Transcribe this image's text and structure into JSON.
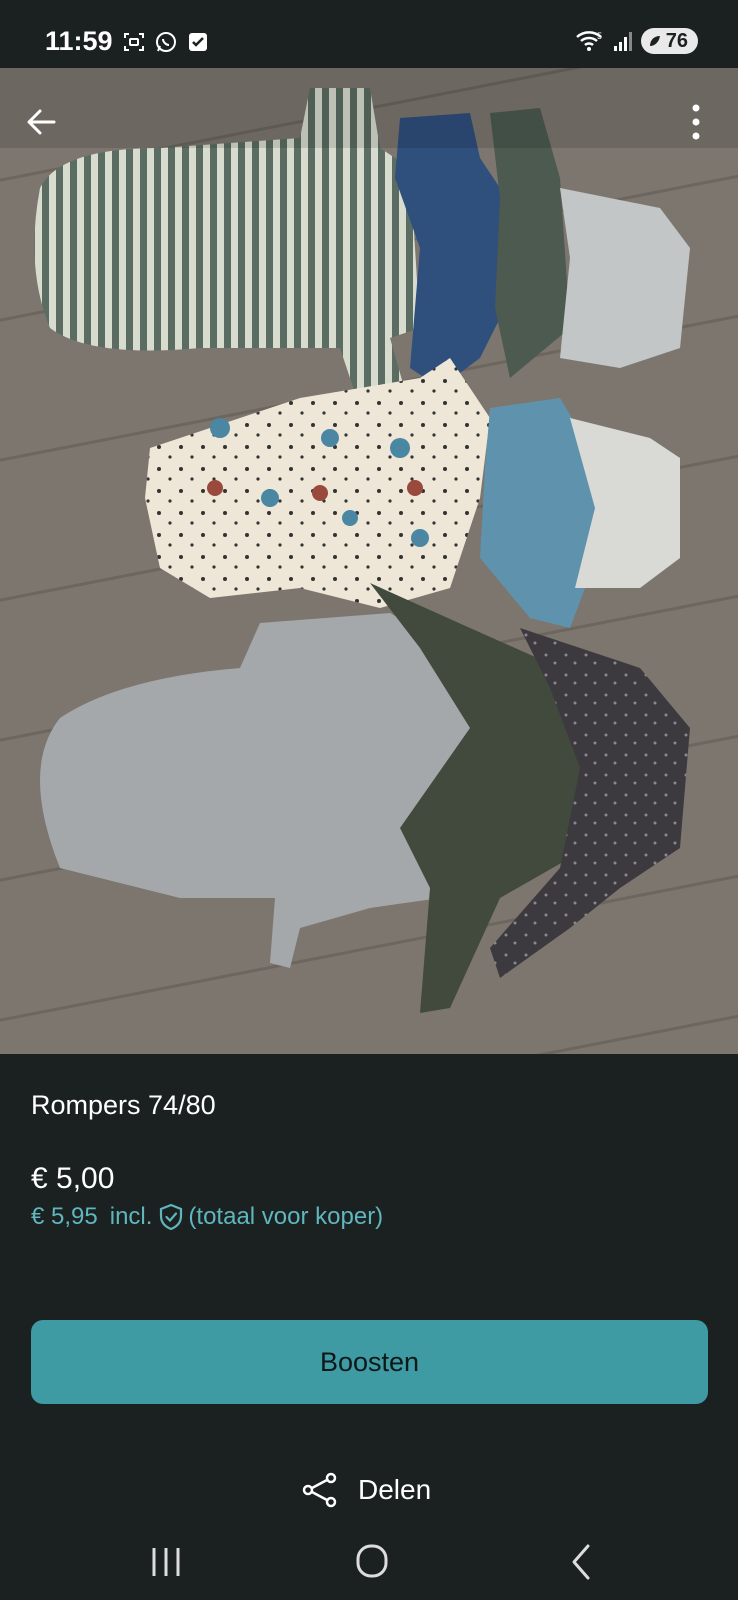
{
  "status_bar": {
    "time": "11:59",
    "battery": "76",
    "left_icons": [
      "screenshot-icon",
      "whatsapp-icon",
      "checkbox-notification-icon"
    ],
    "right_icons": [
      "wifi-icon",
      "signal-icon",
      "battery-icon"
    ]
  },
  "listing": {
    "title": "Rompers 74/80",
    "price": "€ 5,00",
    "buyer_price": "€ 5,95",
    "buyer_incl": "incl.",
    "buyer_note": "(totaal voor koper)"
  },
  "actions": {
    "boost_label": "Boosten",
    "share_label": "Delen"
  },
  "colors": {
    "background": "#1b2121",
    "accent": "#3e9aa3",
    "accent_text": "#5fb6bd"
  },
  "nav": {
    "icons": [
      "recent-apps-icon",
      "home-icon",
      "back-nav-icon"
    ]
  }
}
